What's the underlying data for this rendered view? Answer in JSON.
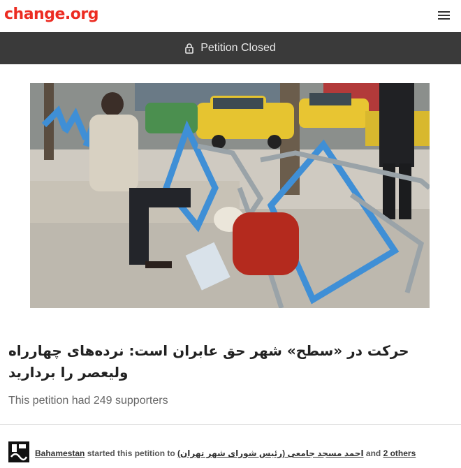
{
  "header": {
    "logo_text": "change.org",
    "menu_icon": "hamburger-menu-icon",
    "brand_color": "#ec2c22"
  },
  "status": {
    "text": "Petition Closed",
    "icon": "lock-icon",
    "background": "#3a3a3a"
  },
  "petition": {
    "title": "حرکت در «سطح» شهر حق عابران است: نرده‌های چهارراه ولیعصر را بردارید",
    "supporters_text": "This petition had 249 supporters"
  },
  "starter": {
    "author": "Bahamestan",
    "middle_text": " started this petition to ",
    "target": "احمد مسجد جامعی (رئیس شورای شهر تهران)",
    "and_text": " and ",
    "others": "2 others"
  }
}
